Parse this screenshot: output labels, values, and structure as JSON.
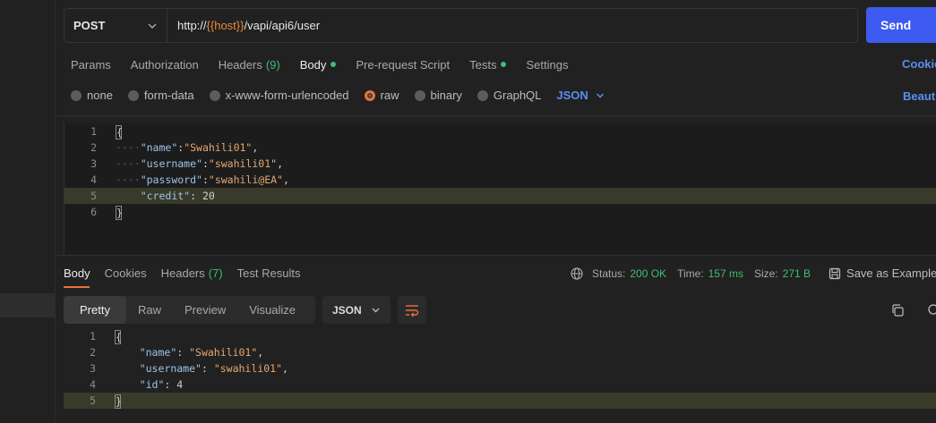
{
  "request": {
    "method": "POST",
    "url_prefix": "http://",
    "url_var": "{{host}}",
    "url_suffix": "/vapi/api6/user",
    "send_label": "Send"
  },
  "request_tabs": [
    {
      "label": "Params"
    },
    {
      "label": "Authorization"
    },
    {
      "label": "Headers",
      "count": "(9)"
    },
    {
      "label": "Body",
      "dot": true,
      "active": true
    },
    {
      "label": "Pre-request Script"
    },
    {
      "label": "Tests",
      "dot": true
    },
    {
      "label": "Settings"
    }
  ],
  "links": {
    "cookies": "Cookie",
    "beautify": "Beauti"
  },
  "body_types": [
    "none",
    "form-data",
    "x-www-form-urlencoded",
    "raw",
    "binary",
    "GraphQL"
  ],
  "body_type_selected": "raw",
  "body_format": "JSON",
  "request_body": {
    "lines": [
      {
        "num": "1",
        "text": "{"
      },
      {
        "num": "2",
        "key": "\"name\"",
        "sep": ":",
        "value": "\"Swahili01\"",
        "tail": ","
      },
      {
        "num": "3",
        "key": "\"username\"",
        "sep": ":",
        "value": "\"swahili01\"",
        "tail": ","
      },
      {
        "num": "4",
        "key": "\"password\"",
        "sep": ":",
        "value": "\"swahili@EA\"",
        "tail": ","
      },
      {
        "num": "5",
        "key": "\"credit\"",
        "sep": ": ",
        "value": "20",
        "tail": ""
      },
      {
        "num": "6",
        "text": "}"
      }
    ]
  },
  "response_tabs": [
    {
      "label": "Body",
      "active": true
    },
    {
      "label": "Cookies"
    },
    {
      "label": "Headers",
      "count": "(7)"
    },
    {
      "label": "Test Results"
    }
  ],
  "response_meta": {
    "status_label": "Status:",
    "status": "200 OK",
    "time_label": "Time:",
    "time": "157 ms",
    "size_label": "Size:",
    "size": "271 B",
    "save_label": "Save as Example"
  },
  "view_modes": [
    "Pretty",
    "Raw",
    "Preview",
    "Visualize"
  ],
  "view_mode_selected": "Pretty",
  "response_format": "JSON",
  "response_body": {
    "lines": [
      {
        "num": "1",
        "text": "{"
      },
      {
        "num": "2",
        "key": "\"name\"",
        "value": "\"Swahili01\"",
        "tail": ","
      },
      {
        "num": "3",
        "key": "\"username\"",
        "value": "\"swahili01\"",
        "tail": ","
      },
      {
        "num": "4",
        "key": "\"id\"",
        "value": "4",
        "tail": ""
      },
      {
        "num": "5",
        "text": "}"
      }
    ]
  },
  "colors": {
    "accent": "#3d5af1",
    "active_tab": "#e5733b",
    "success": "#3ebd74",
    "link": "#5a8ef0"
  }
}
